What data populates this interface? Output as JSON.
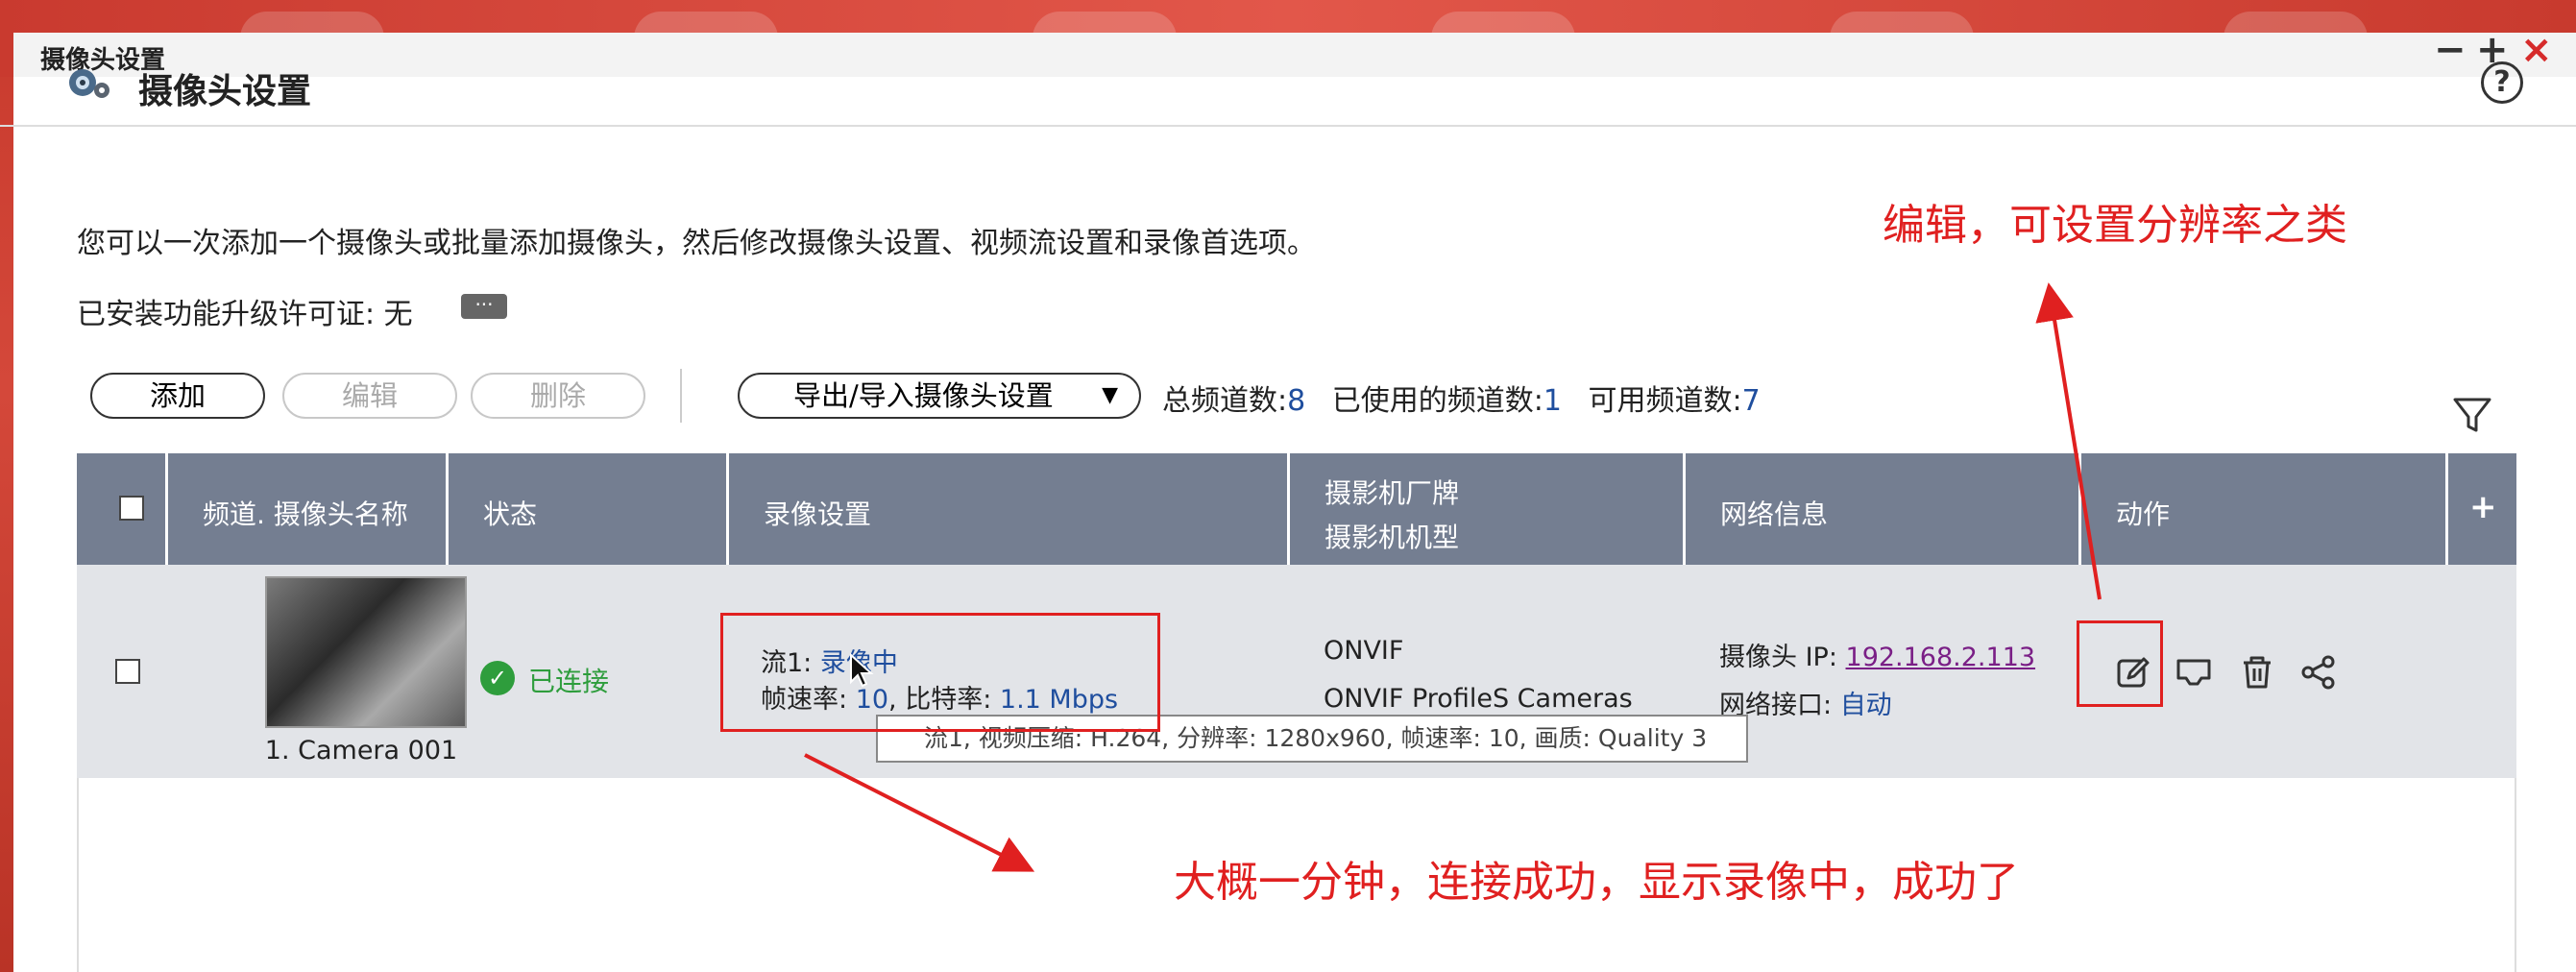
{
  "window": {
    "title": "摄像头设置",
    "controls": {
      "minimize": "−",
      "maximize": "+",
      "close": "×"
    }
  },
  "header": {
    "title": "摄像头设置",
    "help": "?"
  },
  "intro_text": "您可以一次添加一个摄像头或批量添加摄像头，然后修改摄像头设置、视频流设置和录像首选项。",
  "license_text": "已安装功能升级许可证: 无",
  "license_more": "···",
  "toolbar": {
    "add": "添加",
    "edit": "编辑",
    "delete": "删除",
    "export_import": "导出/导入摄像头设置",
    "dropdown_arrow": "▼"
  },
  "counts": {
    "total_label": "总频道数:",
    "total": "8",
    "used_label": "已使用的频道数:",
    "used": "1",
    "available_label": "可用频道数:",
    "available": "7"
  },
  "table": {
    "headers": {
      "channel_name": "频道. 摄像头名称",
      "status": "状态",
      "recording": "录像设置",
      "vendor_line1": "摄影机厂牌",
      "vendor_line2": "摄影机机型",
      "network": "网络信息",
      "actions": "动作",
      "add_column": "+"
    },
    "rows": [
      {
        "camera_name": "1. Camera 001",
        "status": "已连接",
        "stream_label": "流1: ",
        "stream_value": "录像中",
        "fps_label": "帧速率: ",
        "fps_value": "10",
        "bitrate_label": ", 比特率: ",
        "bitrate_value": "1.1 Mbps",
        "vendor": "ONVIF",
        "model": "ONVIF ProfileS Cameras",
        "ip_label": "摄像头 IP: ",
        "ip": "192.168.2.113",
        "port_label": "网络接口: ",
        "port": "自动"
      }
    ]
  },
  "tooltip": "流1, 视频压缩: H.264, 分辨率: 1280x960, 帧速率: 10, 画质: Quality 3",
  "annotations": {
    "edit_note": "编辑，可设置分辨率之类",
    "success_note": "大概一分钟，连接成功，显示录像中，成功了"
  },
  "colors": {
    "header_bg": "#747e91",
    "link_blue": "#1f4e9e",
    "annotation_red": "#e02020",
    "status_green": "#2e9d3c"
  },
  "icons": [
    "edit-icon",
    "monitor-icon",
    "trash-icon",
    "share-icon",
    "filter-icon",
    "help-icon",
    "camera-settings-icon",
    "check-circle-icon"
  ]
}
